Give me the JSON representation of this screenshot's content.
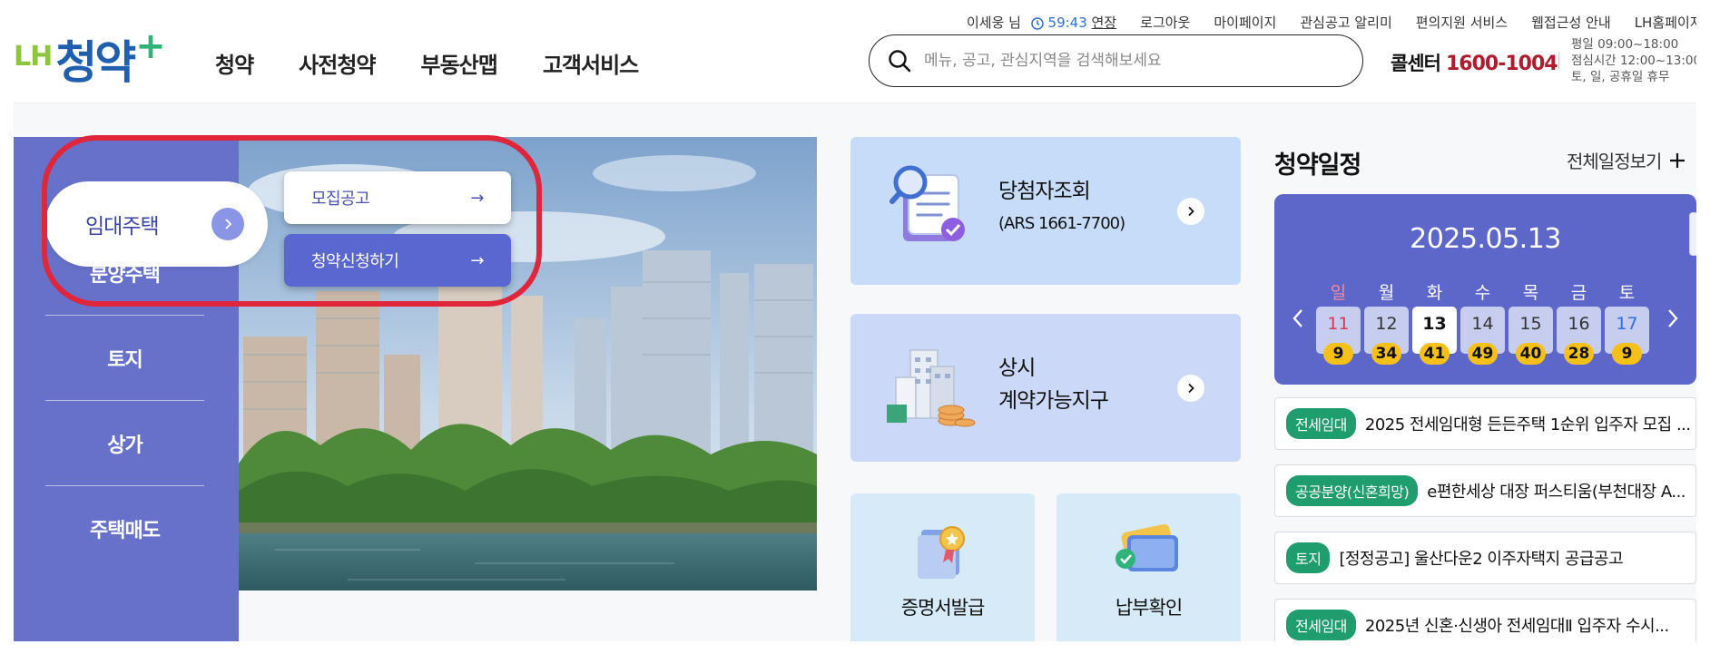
{
  "header": {
    "logo_lh": "LH",
    "logo_main": "청약",
    "logo_plus": "+",
    "nav": [
      "청약",
      "사전청약",
      "부동산맵",
      "고객서비스"
    ],
    "util": {
      "user": "이세웅 님",
      "timer": "59:43",
      "extend": "연장",
      "logout": "로그아웃",
      "mypage": "마이페이지",
      "alert": "관심공고 알리미",
      "accessibility": "편의지원 서비스",
      "web_guide": "웹접근성 안내",
      "lh_home": "LH홈페이지"
    },
    "search_placeholder": "메뉴, 공고, 관심지역을 검색해보세요",
    "callcenter_label": "콜센터",
    "callcenter_number": "1600-1004",
    "hours": [
      "평일 09:00~18:00",
      "점심시간 12:00~13:00",
      "토, 일, 공휴일 휴무"
    ]
  },
  "side_menu": {
    "active": "임대주택",
    "items": [
      "분양주택",
      "토지",
      "상가",
      "주택매도"
    ],
    "submenu": [
      {
        "label": "모집공고",
        "arrow": "→"
      },
      {
        "label": "청약신청하기",
        "arrow": "→"
      }
    ]
  },
  "cards": {
    "winner_title": "당첨자조회",
    "winner_sub": "(ARS 1661-7700)",
    "contract_line1": "상시",
    "contract_line2": "계약가능지구",
    "certificate": "증명서발급",
    "payment": "납부확인"
  },
  "schedule": {
    "title": "청약일정",
    "more": "전체일정보기",
    "date": "2025.05.13",
    "days": [
      {
        "name": "일",
        "date": "11",
        "count": "9",
        "type": "sun"
      },
      {
        "name": "월",
        "date": "12",
        "count": "34",
        "type": ""
      },
      {
        "name": "화",
        "date": "13",
        "count": "41",
        "type": "today"
      },
      {
        "name": "수",
        "date": "14",
        "count": "49",
        "type": ""
      },
      {
        "name": "목",
        "date": "15",
        "count": "40",
        "type": ""
      },
      {
        "name": "금",
        "date": "16",
        "count": "28",
        "type": ""
      },
      {
        "name": "토",
        "date": "17",
        "count": "9",
        "type": "sat"
      }
    ]
  },
  "notices": [
    {
      "badge": "전세임대",
      "text": "2025 전세임대형 든든주택 1순위 입주자 모집 ..."
    },
    {
      "badge": "공공분양(신혼희망)",
      "text": "e편한세상 대장 퍼스티움(부천대장 A..."
    },
    {
      "badge": "토지",
      "text": "[정정공고] 울산다운2 이주자택지 공급공고"
    },
    {
      "badge": "전세임대",
      "text": "2025년 신혼·신생아 전세임대Ⅱ 입주자 수시..."
    }
  ],
  "colors": {
    "brand_blue": "#1f5fae",
    "brand_green": "#8cc63f",
    "menu_purple": "#6771c9",
    "calendar_panel": "#5c67c9",
    "badge_green": "#1f9d6f",
    "count_yellow": "#f6c018",
    "highlight_red": "#e0263b",
    "callcenter_red": "#b01c2e"
  }
}
